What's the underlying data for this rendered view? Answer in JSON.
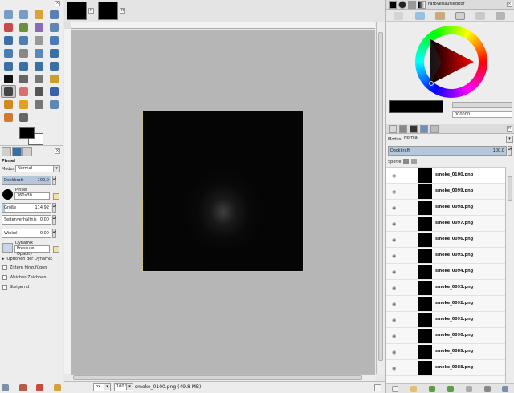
{
  "toolbox": {
    "tools": [
      {
        "name": "rect-select-icon",
        "color": "#7a9bc4"
      },
      {
        "name": "ellipse-select-icon",
        "color": "#7a9bc4"
      },
      {
        "name": "free-select-icon",
        "color": "#d9a23a"
      },
      {
        "name": "fuzzy-select-icon",
        "color": "#5b7fb3"
      },
      {
        "name": "select-by-color-icon",
        "color": "#c94a4a"
      },
      {
        "name": "scissors-select-icon",
        "color": "#6b8f3c"
      },
      {
        "name": "foreground-select-icon",
        "color": "#8a6bb8"
      },
      {
        "name": "paths-icon",
        "color": "#5f87b5"
      },
      {
        "name": "color-picker-icon",
        "color": "#3c6fa3"
      },
      {
        "name": "zoom-icon",
        "color": "#4f7fb0"
      },
      {
        "name": "measure-icon",
        "color": "#999999"
      },
      {
        "name": "move-icon",
        "color": "#4a7bb5"
      },
      {
        "name": "align-icon",
        "color": "#4a7bb5"
      },
      {
        "name": "crop-icon",
        "color": "#888888"
      },
      {
        "name": "rotate-icon",
        "color": "#5a88b8"
      },
      {
        "name": "scale-icon",
        "color": "#3c6fa3"
      },
      {
        "name": "shear-icon",
        "color": "#3c6fa3"
      },
      {
        "name": "perspective-icon",
        "color": "#3c6fa3"
      },
      {
        "name": "flip-icon",
        "color": "#3c6fa3"
      },
      {
        "name": "cage-icon",
        "color": "#3c6fa3"
      },
      {
        "name": "text-icon",
        "color": "#111111"
      },
      {
        "name": "bucket-fill-icon",
        "color": "#666666"
      },
      {
        "name": "blend-icon",
        "color": "#777777"
      },
      {
        "name": "pencil-icon",
        "color": "#c8a030"
      },
      {
        "name": "paintbrush-icon",
        "color": "#444444",
        "active": true
      },
      {
        "name": "eraser-icon",
        "color": "#d97070"
      },
      {
        "name": "airbrush-icon",
        "color": "#555555"
      },
      {
        "name": "ink-icon",
        "color": "#3a62a8"
      },
      {
        "name": "clone-icon",
        "color": "#d08a20"
      },
      {
        "name": "heal-icon",
        "color": "#e0a020"
      },
      {
        "name": "perspective-clone-icon",
        "color": "#777777"
      },
      {
        "name": "blur-icon",
        "color": "#5f87b5"
      },
      {
        "name": "smudge-icon",
        "color": "#d07a30"
      },
      {
        "name": "dodge-burn-icon",
        "color": "#666666"
      }
    ]
  },
  "tool_options": {
    "title": "Pinsel",
    "mode_label": "Modus",
    "mode_value": "Normal",
    "opacity_label": "Deckkraft",
    "opacity_value": "100,0",
    "opacity_fraction": 1.0,
    "brush_label": "Pinsel",
    "brush_name": "360x30",
    "size_label": "Größe",
    "size_value": "114,92",
    "aspect_label": "Seitenverhältnis",
    "aspect_value": "0,00",
    "angle_label": "Winkel",
    "angle_value": "0,00",
    "dynamics_label": "Dynamik",
    "dynamics_value": "Pressure Opacity",
    "dynamics_options": "Optionen der Dynamik",
    "jitter": "Zittern hinzufügen",
    "smooth": "Weiches Zeichnen",
    "incremental": "Steigernd"
  },
  "image_window": {
    "unit": "px",
    "zoom": "100 %",
    "status": "smoke_0100.png (49,8 MB)"
  },
  "colors": {
    "canvas_bg": "#b6b6b6",
    "image_bg": "#050505",
    "selection": "#d4c94a",
    "accent": "#b4c7dc"
  },
  "right_dock": {
    "top_tab_label": "Farbverlaufseditor",
    "hex_value": "000000",
    "mode_label": "Modus:",
    "mode_value": "Normal",
    "opacity_label": "Deckkraft",
    "opacity_value": "100,0",
    "lock_label": "Sperre:",
    "layers": [
      "smoke_0100.png",
      "smoke_0099.png",
      "smoke_0098.png",
      "smoke_0097.png",
      "smoke_0096.png",
      "smoke_0095.png",
      "smoke_0094.png",
      "smoke_0093.png",
      "smoke_0092.png",
      "smoke_0091.png",
      "smoke_0090.png",
      "smoke_0089.png",
      "smoke_0088.png"
    ]
  }
}
